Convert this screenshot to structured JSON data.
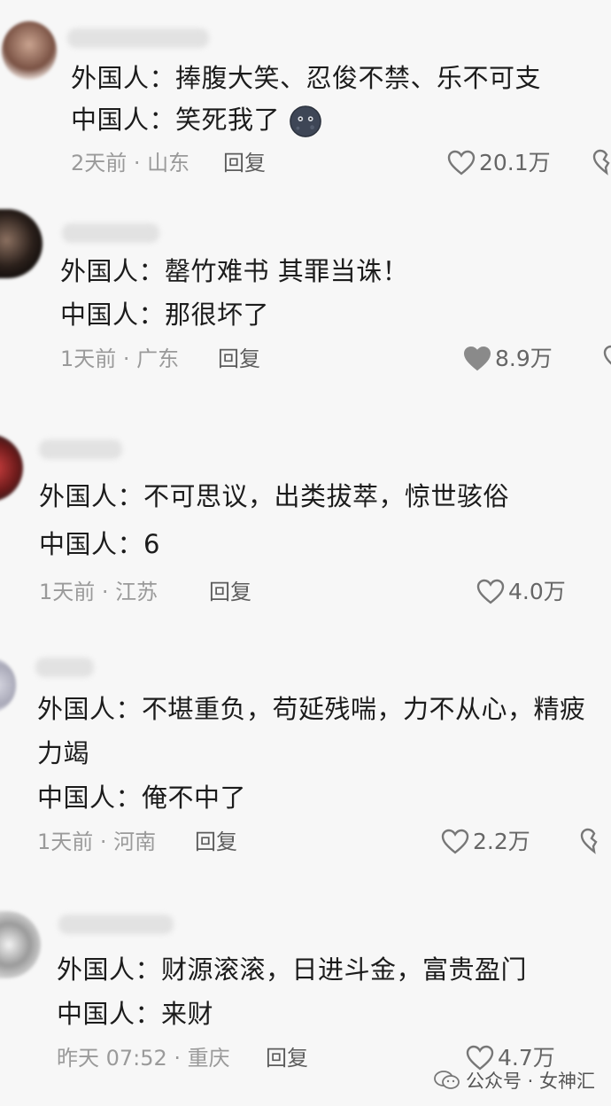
{
  "comments": [
    {
      "foreign_label": "外国人：",
      "foreign_text": "捧腹大笑、忍俊不禁、乐不可支",
      "chinese_label": "中国人：",
      "chinese_text": "笑死我了",
      "time_location": "2天前 · 山东",
      "reply": "回复",
      "likes": "20.1万",
      "liked": false,
      "emoji_icon": "moon-face-emoji-icon"
    },
    {
      "foreign_label": "外国人：",
      "foreign_text": "罄竹难书 其罪当诛！",
      "chinese_label": "中国人：",
      "chinese_text": "那很坏了",
      "time_location": "1天前 · 广东",
      "reply": "回复",
      "likes": "8.9万",
      "liked": true
    },
    {
      "foreign_label": "外国人：",
      "foreign_text": "不可思议，出类拔萃，惊世骇俗",
      "chinese_label": "中国人：",
      "chinese_text": "6",
      "time_location": "1天前 · 江苏",
      "reply": "回复",
      "likes": "4.0万",
      "liked": false
    },
    {
      "foreign_label": "外国人：",
      "foreign_text": "不堪重负，苟延残喘，力不从心，精疲",
      "foreign_text_cont": "力竭",
      "chinese_label": "中国人：",
      "chinese_text": "俺不中了",
      "time_location": "1天前 · 河南",
      "reply": "回复",
      "likes": "2.2万",
      "liked": false
    },
    {
      "foreign_label": "外国人：",
      "foreign_text": "财源滚滚，日进斗金，富贵盈门",
      "chinese_label": "中国人：",
      "chinese_text": "来财",
      "time_location": "昨天 07:52 · 重庆",
      "reply": "回复",
      "likes": "4.7万",
      "liked": false
    }
  ],
  "watermark": {
    "text": "公众号 · 女神汇",
    "icon": "wechat-icon"
  },
  "colors": {
    "text": "#1c1c1c",
    "meta": "#9a9a9a",
    "heart_filled": "#8a8a8a",
    "background": "#f7f7f7"
  }
}
